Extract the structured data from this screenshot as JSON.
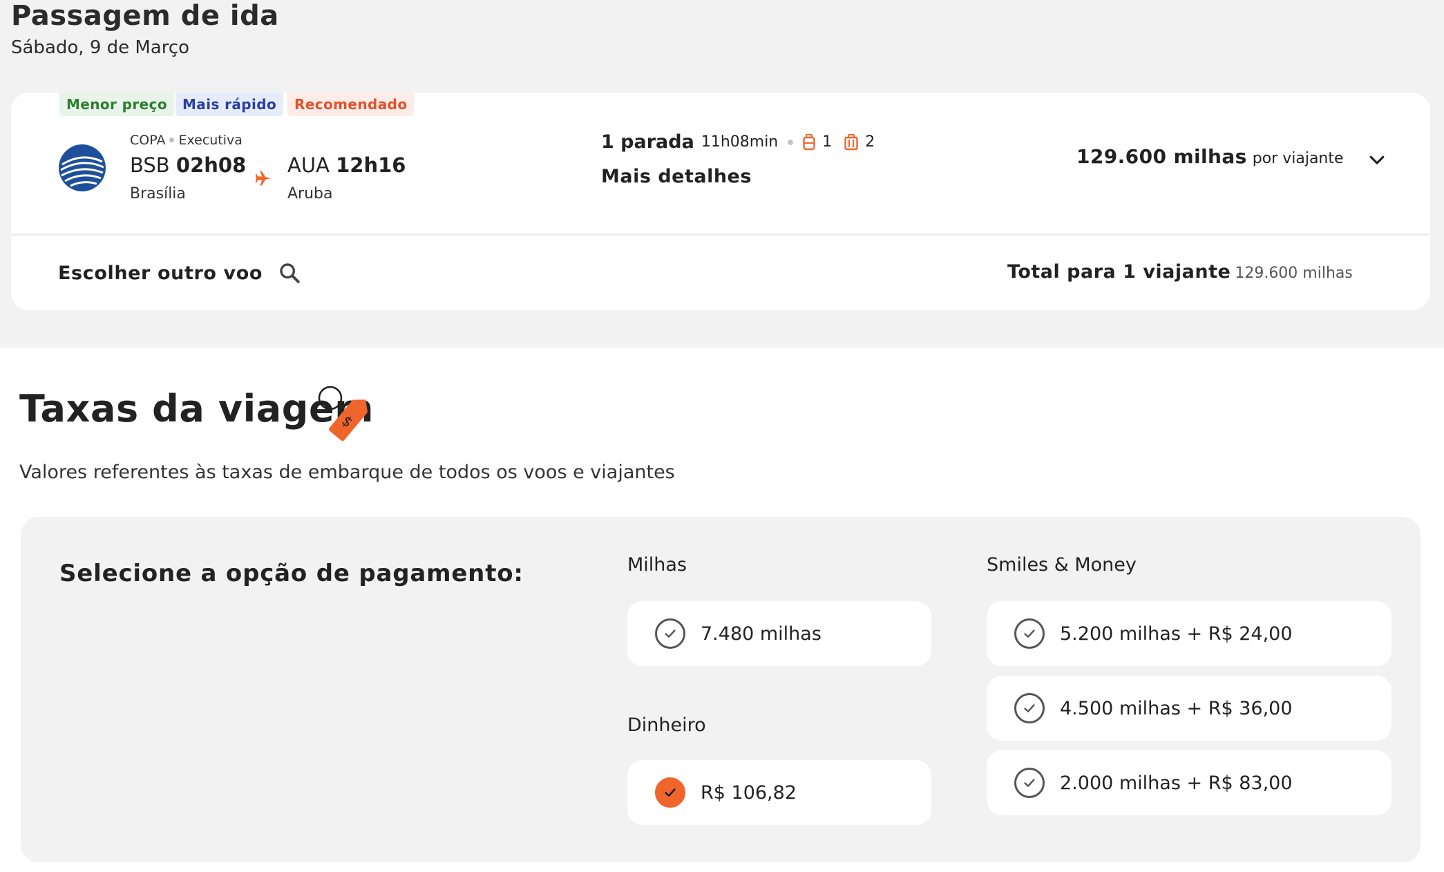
{
  "header": {
    "title": "Passagem de ida",
    "date": "Sábado, 9 de Março"
  },
  "flight": {
    "badges": [
      "Menor preço",
      "Mais rápido",
      "Recomendado"
    ],
    "airline": "COPA",
    "cabin": "Executiva",
    "departure": {
      "code": "BSB",
      "time": "02h08",
      "city": "Brasília"
    },
    "arrival": {
      "code": "AUA",
      "time": "12h16",
      "city": "Aruba"
    },
    "stops": "1 parada",
    "duration": "11h08min",
    "carry_on_count": "1",
    "checked_bag_count": "2",
    "more_details": "Mais detalhes",
    "price": "129.600 milhas",
    "price_suffix": "por viajante",
    "choose_other": "Escolher outro voo",
    "total_label": "Total para 1 viajante",
    "total_amount": "129.600 milhas"
  },
  "fees": {
    "title": "Taxas da viagem",
    "subtitle": "Valores referentes às taxas de embarque de todos os voos e viajantes",
    "payment_heading": "Selecione a opção de pagamento:",
    "miles_label": "Milhas",
    "miles_option": "7.480 milhas",
    "cash_label": "Dinheiro",
    "cash_option": "R$ 106,82",
    "mixed_label": "Smiles & Money",
    "mixed_options": [
      "5.200 milhas + R$ 24,00",
      "4.500 milhas + R$ 36,00",
      "2.000 milhas + R$ 83,00"
    ]
  },
  "colors": {
    "accent": "#f0652b",
    "brand_blue": "#1e4f9c",
    "badge_green": "#2e7d32",
    "badge_blue": "#2a3f9f",
    "badge_red": "#e0522a"
  },
  "icons": [
    "airline-logo-icon",
    "plane-icon",
    "carry-on-bag-icon",
    "checked-bag-icon",
    "chevron-down-icon",
    "search-icon",
    "price-tag-icon",
    "check-icon"
  ]
}
